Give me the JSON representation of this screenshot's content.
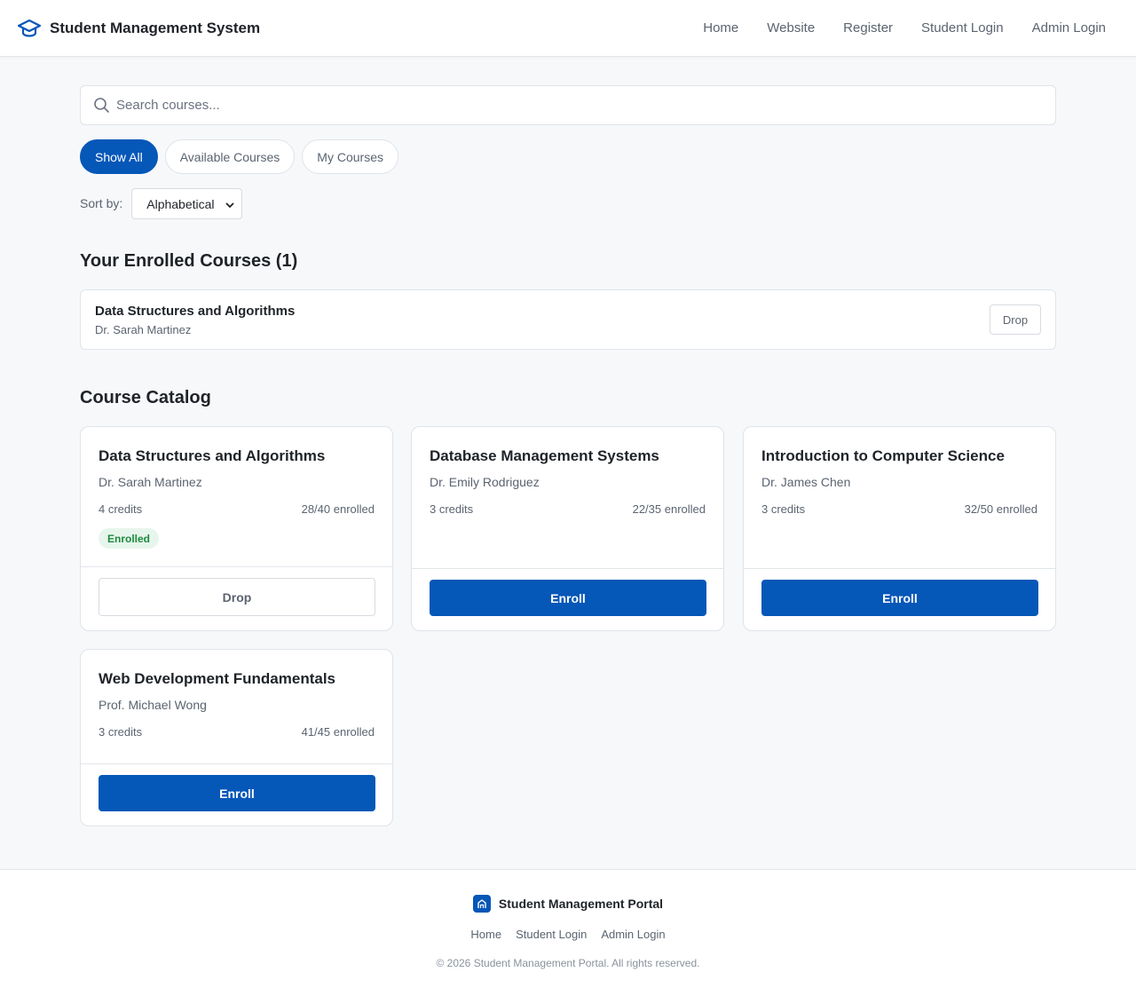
{
  "header": {
    "brand_title": "Student Management System",
    "nav": [
      "Home",
      "Website",
      "Register",
      "Student Login",
      "Admin Login"
    ]
  },
  "search": {
    "placeholder": "Search courses...",
    "value": ""
  },
  "filters": [
    "Show All",
    "Available Courses",
    "My Courses"
  ],
  "sort": {
    "label": "Sort by:",
    "selected": "Alphabetical"
  },
  "enrolled": {
    "heading": "Your Enrolled Courses (1)",
    "items": [
      {
        "title": "Data Structures and Algorithms",
        "instructor": "Dr. Sarah Martinez",
        "action": "Drop"
      }
    ]
  },
  "catalog": {
    "heading": "Course Catalog",
    "courses": [
      {
        "title": "Data Structures and Algorithms",
        "instructor": "Dr. Sarah Martinez",
        "credits": "4 credits",
        "enrolled": "28/40 enrolled",
        "badge": "Enrolled",
        "action": "Drop"
      },
      {
        "title": "Database Management Systems",
        "instructor": "Dr. Emily Rodriguez",
        "credits": "3 credits",
        "enrolled": "22/35 enrolled",
        "action": "Enroll"
      },
      {
        "title": "Introduction to Computer Science",
        "instructor": "Dr. James Chen",
        "credits": "3 credits",
        "enrolled": "32/50 enrolled",
        "action": "Enroll"
      },
      {
        "title": "Web Development Fundamentals",
        "instructor": "Prof. Michael Wong",
        "credits": "3 credits",
        "enrolled": "41/45 enrolled",
        "action": "Enroll"
      }
    ]
  },
  "footer": {
    "brand": "Student Management Portal",
    "links": [
      "Home",
      "Student Login",
      "Admin Login"
    ],
    "copyright": "© 2026 Student Management Portal. All rights reserved."
  },
  "colors": {
    "primary": "#0557b8",
    "badge_bg": "#e7f6ec",
    "badge_text": "#1d8a3f"
  }
}
